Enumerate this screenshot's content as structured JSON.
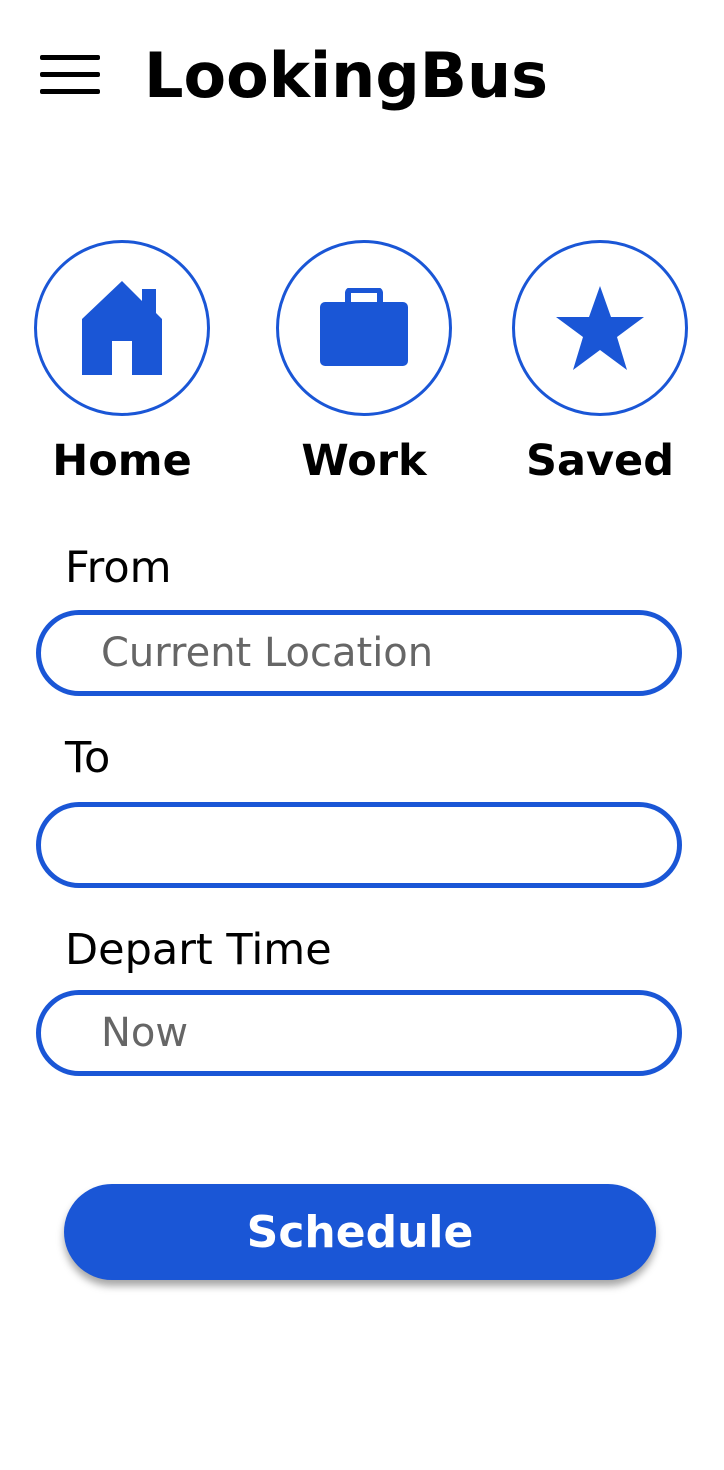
{
  "header": {
    "title": "LookingBus",
    "menu_icon": "hamburger-menu-icon"
  },
  "quick_destinations": [
    {
      "label": "Home",
      "icon": "home-icon"
    },
    {
      "label": "Work",
      "icon": "briefcase-icon"
    },
    {
      "label": "Saved",
      "icon": "star-icon"
    }
  ],
  "form": {
    "from": {
      "label": "From",
      "value": "",
      "placeholder": "Current Location"
    },
    "to": {
      "label": "To",
      "value": "",
      "placeholder": ""
    },
    "depart_time": {
      "label": "Depart Time",
      "value": "",
      "placeholder": "Now"
    }
  },
  "actions": {
    "schedule_label": "Schedule"
  },
  "colors": {
    "accent": "#1a56d6",
    "background": "#ffffff",
    "text": "#000000",
    "placeholder": "#666666"
  }
}
